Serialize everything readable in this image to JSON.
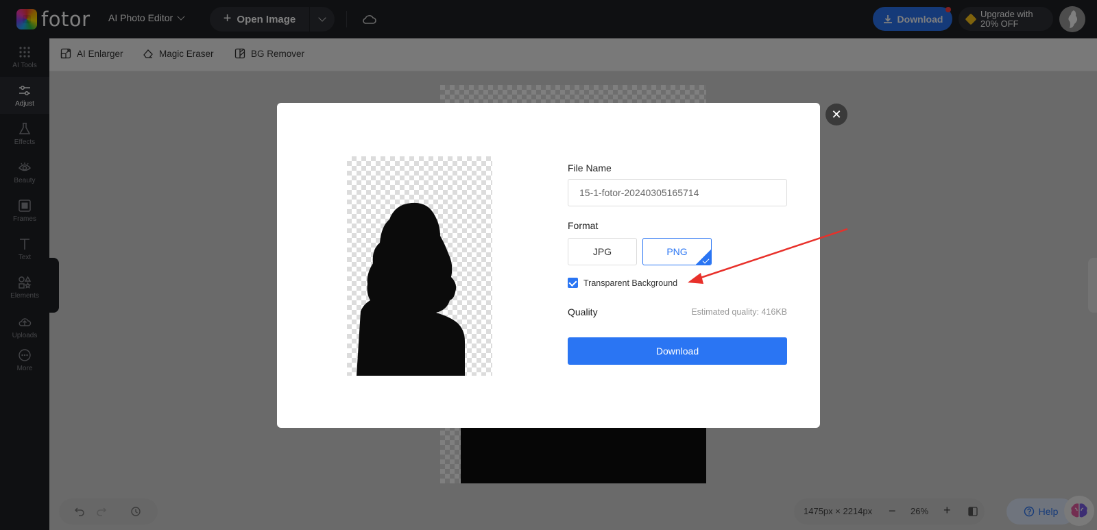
{
  "brand": {
    "name": "fotor"
  },
  "topbar": {
    "app_switch": "AI Photo Editor",
    "open_image": "Open Image",
    "download": "Download",
    "upgrade_line1": "Upgrade with",
    "upgrade_line2": "20% OFF",
    "accent": "#2a75f3"
  },
  "rail": {
    "items": [
      {
        "label": "AI Tools",
        "icon": "grid-icon"
      },
      {
        "label": "Adjust",
        "icon": "sliders-icon"
      },
      {
        "label": "Effects",
        "icon": "flask-icon"
      },
      {
        "label": "Beauty",
        "icon": "eye-icon"
      },
      {
        "label": "Frames",
        "icon": "frame-icon"
      },
      {
        "label": "Text",
        "icon": "text-icon"
      },
      {
        "label": "Elements",
        "icon": "shapes-icon"
      },
      {
        "label": "Uploads",
        "icon": "cloud-upload-icon"
      },
      {
        "label": "More",
        "icon": "more-icon"
      }
    ]
  },
  "subbar": {
    "enlarger": "AI Enlarger",
    "eraser": "Magic Eraser",
    "bg_remover": "BG Remover"
  },
  "modal": {
    "file_name_label": "File Name",
    "file_name_value": "15-1-fotor-20240305165714",
    "format_label": "Format",
    "format_options": [
      "JPG",
      "PNG"
    ],
    "format_selected": "PNG",
    "transparent_label": "Transparent Background",
    "transparent_checked": true,
    "quality_label": "Quality",
    "estimated_quality": "Estimated quality: 416KB",
    "download_button": "Download"
  },
  "bottom": {
    "dimensions": "1475px × 2214px",
    "zoom": "26%",
    "help": "Help"
  }
}
